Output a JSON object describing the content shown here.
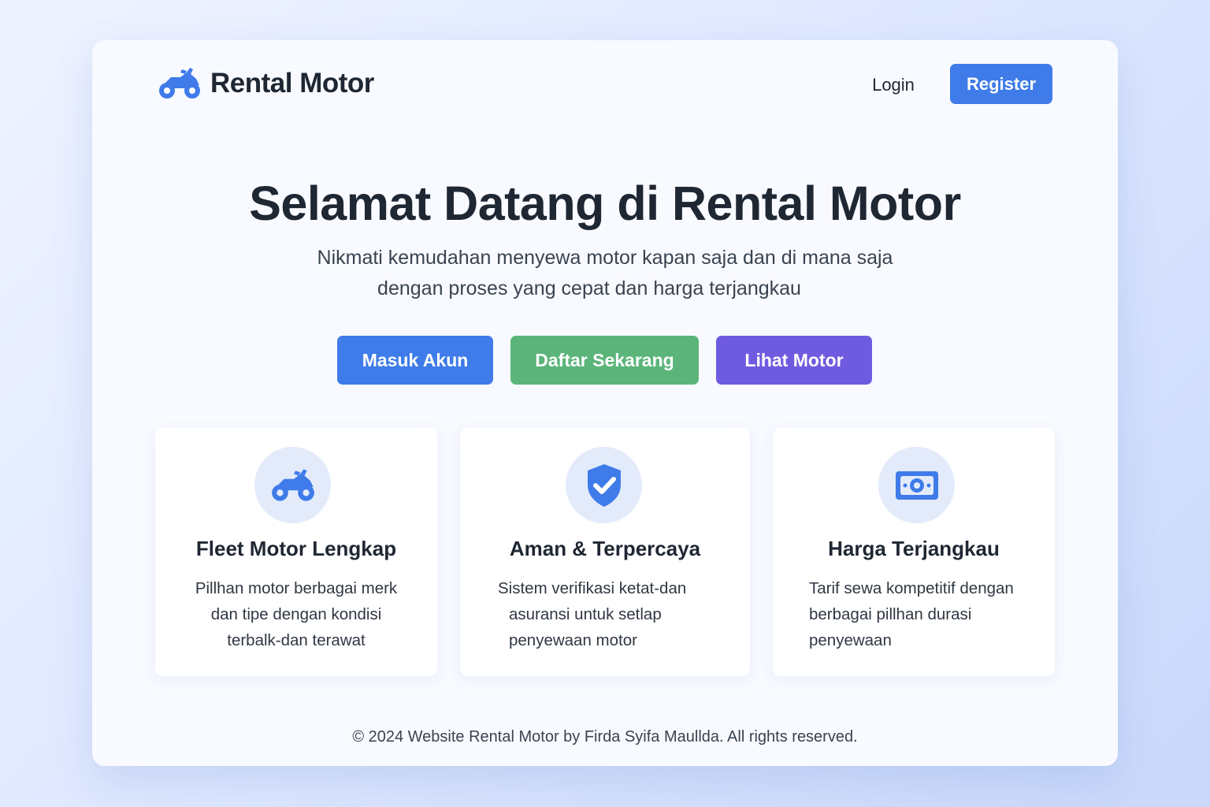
{
  "app": {
    "brand_name": "Rental Motor",
    "brand_icon": "motorcycle-icon",
    "accent_color": "#3f7be9"
  },
  "nav": {
    "login_label": "Login",
    "register_label": "Register"
  },
  "hero": {
    "title": "Selamat Datang di Rental Motor",
    "subtitle_lines": [
      "Nikmati kemudahan menyewa motor kapan saja dan di mana saja",
      "dengan proses yang cepat dan harga terjangkau"
    ],
    "buttons": [
      {
        "label": "Masuk Akun",
        "color": "#3f7be9"
      },
      {
        "label": "Daftar Sekarang",
        "color": "#5bb57a"
      },
      {
        "label": "Lihat Motor",
        "color": "#6f5be0"
      }
    ]
  },
  "features": [
    {
      "icon": "motorcycle-icon",
      "title": "Fleet Motor Lengkap",
      "desc_lines": [
        "Pillhan motor berbagai merk",
        "dan tipe dengan kondisi",
        "terbalk-dan terawat"
      ]
    },
    {
      "icon": "shield-check-icon",
      "title": "Aman & Terpercaya",
      "desc_lines": [
        "Sistem verifikasi ketat-dan",
        "asuransi untuk setlap",
        "penyewaan motor"
      ]
    },
    {
      "icon": "money-icon",
      "title": "Harga Terjangkau",
      "desc_lines": [
        "Tarif sewa kompetitif dengan",
        "berbagai pillhan durasi",
        "penyewaan"
      ]
    }
  ],
  "footer": {
    "text": "© 2024 Website Rental Motor by Firda Syifa Maullda. All rights reserved."
  }
}
